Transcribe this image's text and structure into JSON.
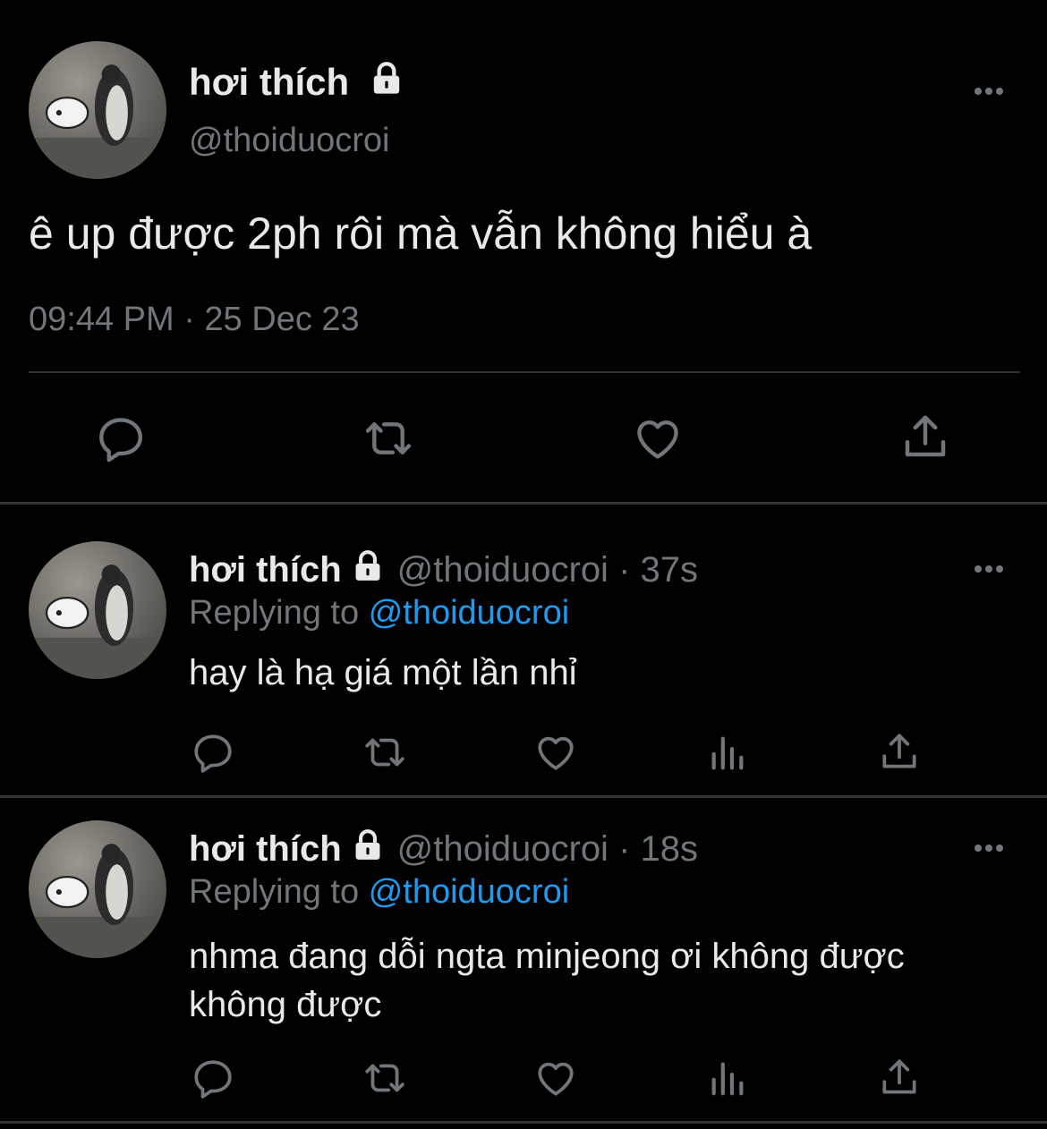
{
  "main_tweet": {
    "display_name": "hơi thích",
    "handle": "@thoiduocroi",
    "text": "ê up được 2ph rôi mà vẫn không hiểu à",
    "timestamp": "09:44 PM · 25 Dec 23"
  },
  "replies": [
    {
      "display_name": "hơi thích",
      "handle": "@thoiduocroi",
      "age": "· 37s",
      "replying_prefix": "Replying to",
      "replying_handle": "@thoiduocroi",
      "text": "hay là hạ giá một lần nhỉ"
    },
    {
      "display_name": "hơi thích",
      "handle": "@thoiduocroi",
      "age": "· 18s",
      "replying_prefix": "Replying to",
      "replying_handle": "@thoiduocroi",
      "text_line1": "nhma đang dỗi ngta minjeong ơi không được",
      "text_line2": "không được"
    }
  ],
  "icons": [
    "reply-icon",
    "retweet-icon",
    "like-icon",
    "views-icon",
    "share-icon",
    "more-icon",
    "lock-icon"
  ],
  "colors": {
    "background": "#000000",
    "text": "#e7e9ea",
    "muted": "#71767b",
    "link": "#1d9bf0",
    "divider": "#2f3336"
  }
}
